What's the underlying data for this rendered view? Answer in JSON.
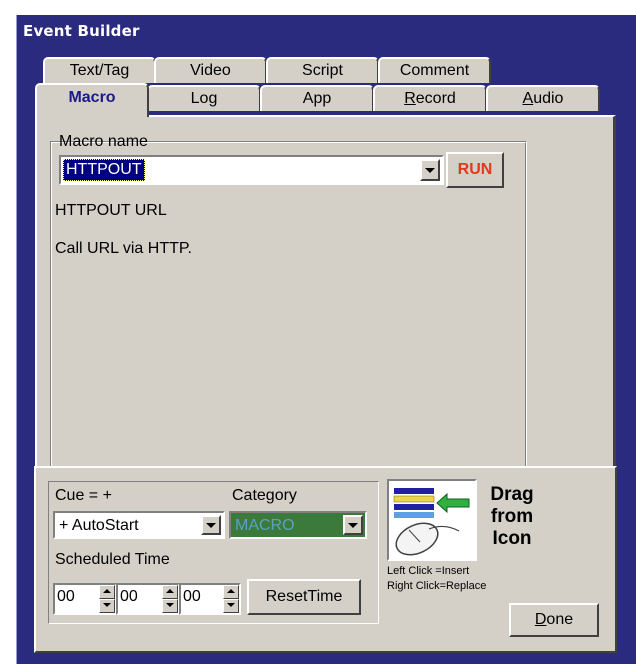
{
  "window": {
    "title": "Event Builder"
  },
  "tabs": {
    "back_row": [
      "Text/Tag",
      "Video",
      "Script",
      "Comment"
    ],
    "front_row": [
      "Macro",
      "Log",
      "App",
      "Record",
      "Audio"
    ],
    "active": "Macro"
  },
  "macro": {
    "name_label": "Macro name",
    "name_value": "HTTPOUT",
    "run_label": "RUN",
    "title_text": "HTTPOUT URL",
    "description": "Call URL via HTTP."
  },
  "cue": {
    "label": "Cue = +",
    "value": "+ AutoStart"
  },
  "category": {
    "label": "Category",
    "value": "MACRO"
  },
  "scheduled": {
    "label": "Scheduled Time",
    "hours": "00",
    "minutes": "00",
    "seconds": "00",
    "reset_label": "ResetTime"
  },
  "drag": {
    "line1": "Drag",
    "line2": "from",
    "line3": "Icon",
    "hint_left": "Left Click  =Insert",
    "hint_right": "Right Click=Replace",
    "icon": "drag-insert-icon"
  },
  "done_label": "Done",
  "colors": {
    "title_bg": "#2a2a7e",
    "face": "#d4d0c8",
    "run_text": "#e03a1a",
    "category_bg": "#3c7a3c",
    "category_text": "#5aa0c8",
    "selection": "#000080"
  }
}
